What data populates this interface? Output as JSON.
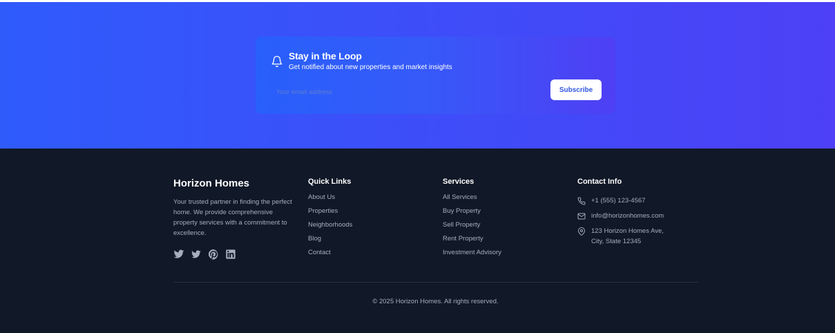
{
  "newsletter": {
    "title": "Stay in the Loop",
    "subtitle": "Get notified about new properties and market insights",
    "email_placeholder": "Your email address",
    "subscribe_label": "Subscribe"
  },
  "brand": {
    "name": "Horizon Homes",
    "description": "Your trusted partner in finding the perfect home. We provide comprehensive property services with a commitment to excellence.",
    "socials": [
      "twitter-icon",
      "twitter-icon",
      "pinterest-icon",
      "linkedin-icon"
    ]
  },
  "quick_links": {
    "title": "Quick Links",
    "items": [
      "About Us",
      "Properties",
      "Neighborhoods",
      "Blog",
      "Contact"
    ]
  },
  "services": {
    "title": "Services",
    "items": [
      "All Services",
      "Buy Property",
      "Sell Property",
      "Rent Property",
      "Investment Advisory"
    ]
  },
  "contact": {
    "title": "Contact Info",
    "phone": "+1 (555) 123-4567",
    "email": "info@horizonhomes.com",
    "address_line1": "123 Horizon Homes Ave,",
    "address_line2": "City, State 12345"
  },
  "copyright": "© 2025 Horizon Homes. All rights reserved.",
  "colors": {
    "band_gradient_start": "#2f5bfb",
    "band_gradient_end": "#4d40f6",
    "footer_bg": "#111827",
    "muted_text": "#a6afbd"
  }
}
